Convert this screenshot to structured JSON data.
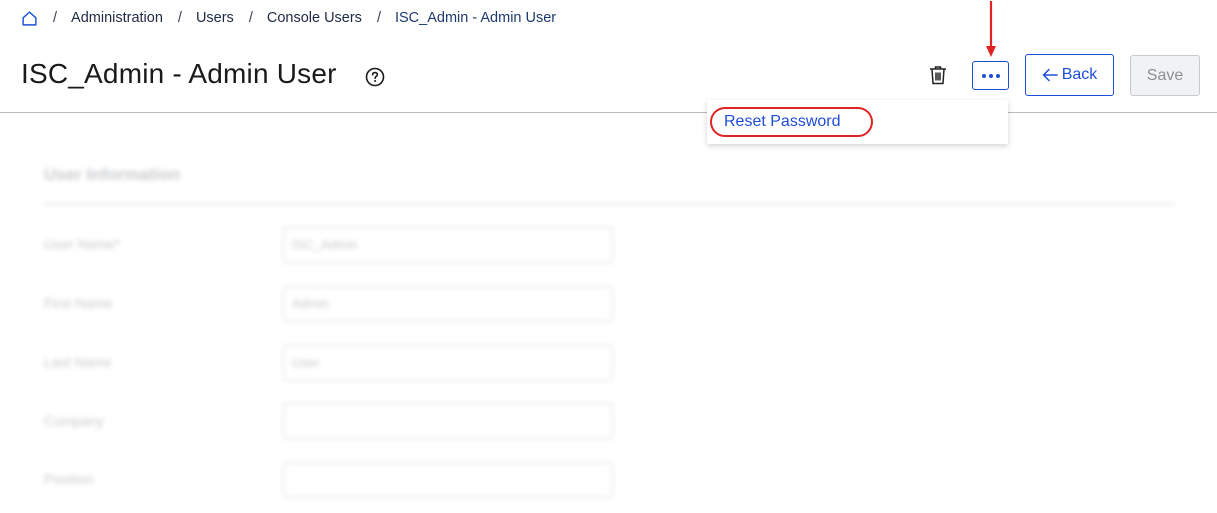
{
  "breadcrumb": {
    "home_icon": "home-icon",
    "separator": "/",
    "items": [
      "Administration",
      "Users",
      "Console Users",
      "ISC_Admin - Admin User"
    ]
  },
  "page": {
    "title": "ISC_Admin - Admin User",
    "help_icon": "question-circle-icon"
  },
  "toolbar": {
    "delete_icon": "trash-icon",
    "more_icon": "ellipsis-icon",
    "back_label": "Back",
    "back_icon": "arrow-left-icon",
    "save_label": "Save"
  },
  "dropdown": {
    "items": [
      "Reset Password"
    ]
  },
  "form": {
    "section_title": "User Information",
    "fields": [
      {
        "label": "User Name*",
        "value": "ISC_Admin"
      },
      {
        "label": "First Name",
        "value": "Admin"
      },
      {
        "label": "Last Name",
        "value": "User"
      },
      {
        "label": "Company",
        "value": ""
      },
      {
        "label": "Position",
        "value": ""
      }
    ]
  },
  "colors": {
    "accent": "#1d4ed8",
    "annotation": "#e02424",
    "breadcrumb_current": "#1e3a6e"
  }
}
